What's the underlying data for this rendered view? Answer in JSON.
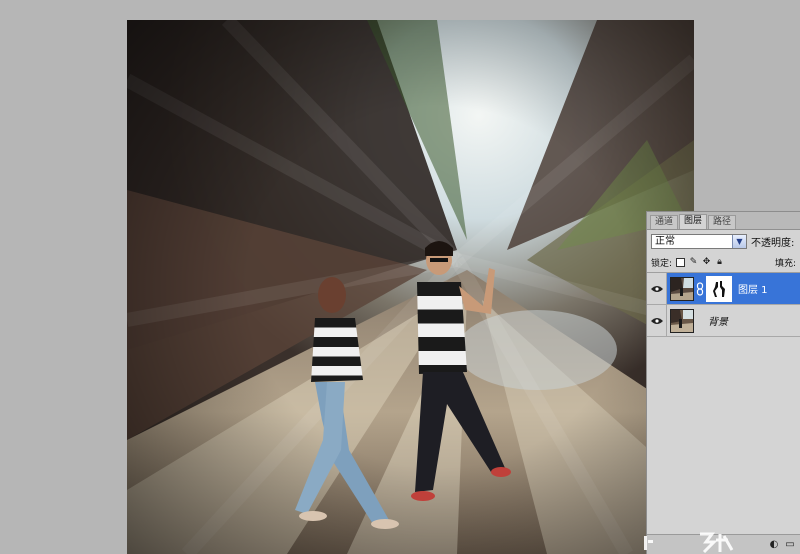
{
  "layers_panel": {
    "tabs": [
      {
        "label": "通道"
      },
      {
        "label": "图层"
      },
      {
        "label": "路径"
      }
    ],
    "active_tab": "图层",
    "blend_mode": "正常",
    "opacity_label": "不透明度:",
    "lock_label": "锁定:",
    "fill_label": "填充:",
    "layers": [
      {
        "name": "图层 1",
        "selected": true,
        "has_mask": true,
        "visible": true
      },
      {
        "name": "背景",
        "selected": false,
        "has_mask": false,
        "visible": true
      }
    ]
  },
  "icons": {
    "eye": "eye-icon",
    "chain": "link-chain-icon",
    "dropdown": "chevron-down-icon",
    "lock_transparent": "lock-transparent-pixels-icon",
    "lock_brush": "lock-image-pixels-icon",
    "lock_move": "lock-position-icon",
    "lock_all": "lock-all-icon"
  },
  "colors": {
    "workspace": "#b6b6b6",
    "panel": "#d4d4d4",
    "selection": "#3874d8"
  }
}
